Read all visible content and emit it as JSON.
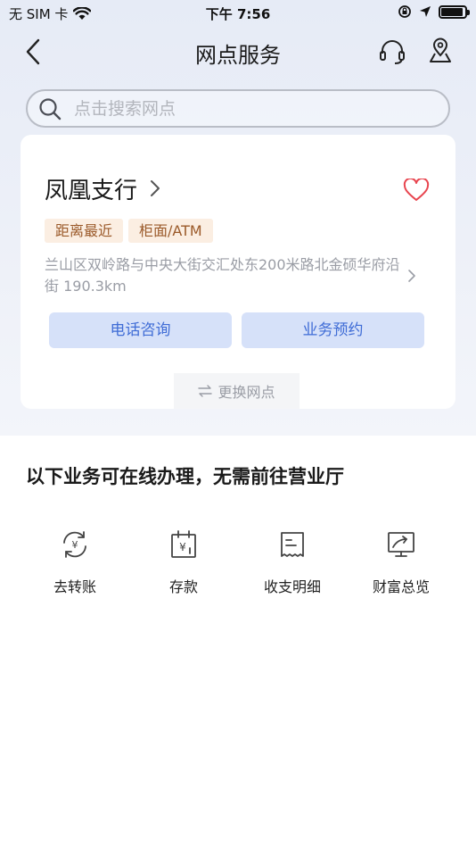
{
  "status_bar": {
    "carrier": "无 SIM 卡",
    "time": "下午 7:56"
  },
  "nav": {
    "title": "网点服务",
    "icons": [
      "back-icon",
      "headset-icon",
      "location-pin-icon"
    ]
  },
  "search": {
    "placeholder": "点击搜索网点"
  },
  "branch": {
    "name": "凤凰支行",
    "tags": [
      "距离最近",
      "柜面/ATM"
    ],
    "address": "兰山区双岭路与中央大街交汇处东200米路北金硕华府沿街 190.3km",
    "call_label": "电话咨询",
    "book_label": "业务预约",
    "switch_label": "更换网点"
  },
  "online": {
    "title": "以下业务可在线办理，无需前往营业厅",
    "items": [
      {
        "label": "去转账",
        "icon": "transfer-icon"
      },
      {
        "label": "存款",
        "icon": "deposit-icon"
      },
      {
        "label": "收支明细",
        "icon": "statement-icon"
      },
      {
        "label": "财富总览",
        "icon": "wealth-overview-icon"
      }
    ]
  },
  "colors": {
    "accent": "#3f6cd6",
    "button_bg": "#d6e1f9",
    "tag_bg": "#fbeee2",
    "tag_text": "#9b5a2a",
    "heart": "#e8454f",
    "icon": "#444444"
  }
}
